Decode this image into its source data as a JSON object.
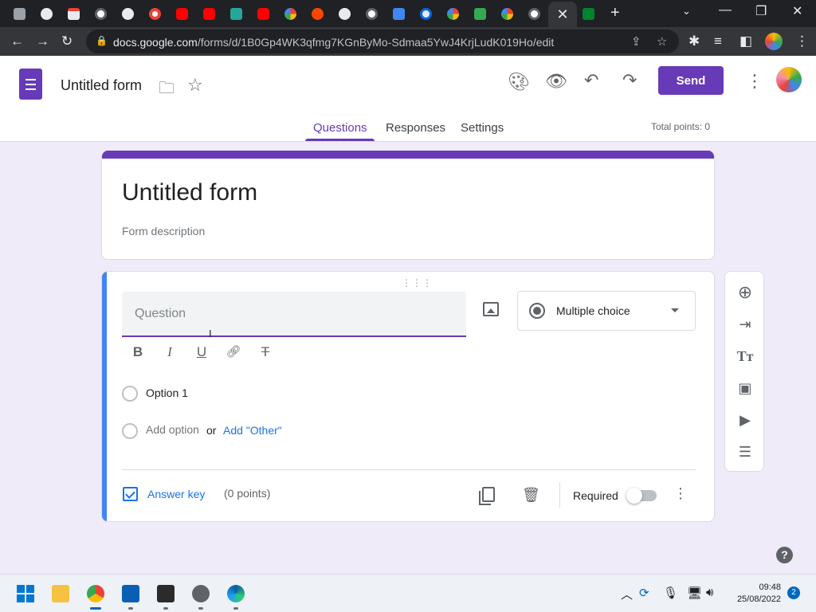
{
  "browser": {
    "active_tab_close": "✕",
    "new_tab": "+",
    "url_host": "docs.google.com",
    "url_path": "/forms/d/1B0Gp4WK3qfmg7KGnByMo-Sdmaa5YwJ4KrjLudK019Ho/edit"
  },
  "forms_header": {
    "doc_title": "Untitled form",
    "send_label": "Send",
    "tabs": [
      "Questions",
      "Responses",
      "Settings"
    ],
    "active_tab": "Questions",
    "total_points": "Total points: 0",
    "accent": "#673ab7"
  },
  "title_card": {
    "title": "Untitled form",
    "description_placeholder": "Form description"
  },
  "question_card": {
    "question_placeholder": "Question",
    "question_type": "Multiple choice",
    "format_buttons": [
      "B",
      "I",
      "U",
      "link",
      "clear-format"
    ],
    "options": [
      {
        "label": "Option 1"
      }
    ],
    "add_option": "Add option",
    "or_text": "or",
    "add_other": "Add \"Other\"",
    "answer_key": "Answer key",
    "points": "(0 points)",
    "required_label": "Required",
    "required": false
  },
  "floating_toolbar": [
    "add-question-icon",
    "import-questions-icon",
    "add-title-icon",
    "add-image-icon",
    "add-video-icon",
    "add-section-icon"
  ],
  "taskbar": {
    "time": "09:48",
    "date": "25/08/2022",
    "notifications": "2"
  }
}
